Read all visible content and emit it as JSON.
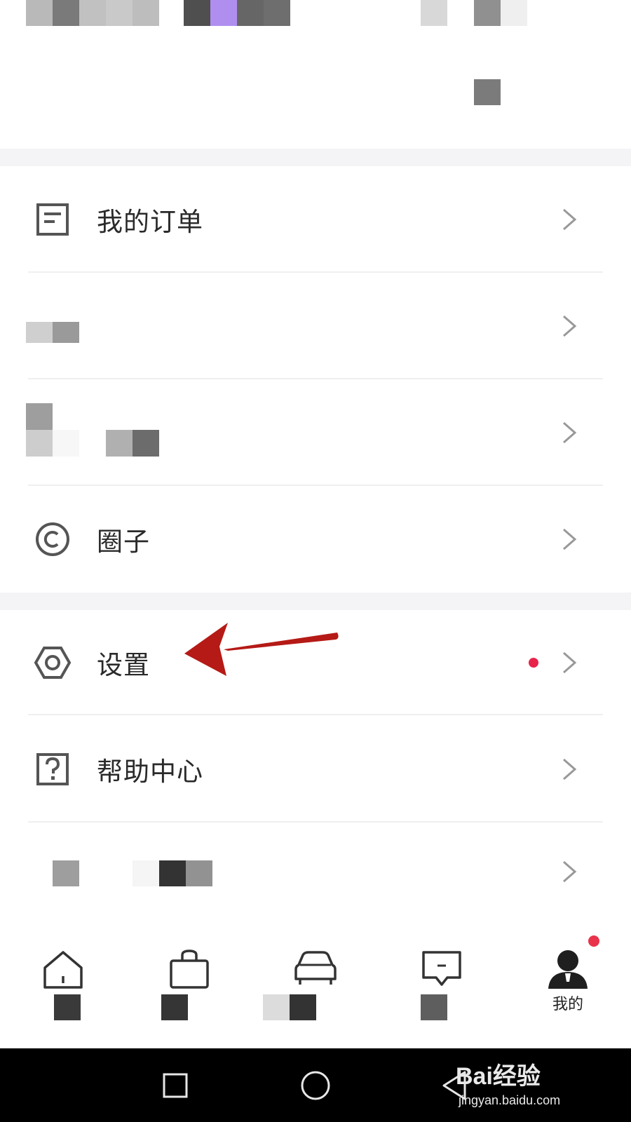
{
  "menu": {
    "orders_label": "我的订单",
    "circle_label": "圈子",
    "settings_label": "设置",
    "help_label": "帮助中心"
  },
  "tabbar": {
    "mine_label": "我的"
  },
  "watermark": {
    "brand": "Bai经验",
    "url": "jingyan.baidu.com"
  },
  "colors": {
    "accent_dot": "#e8244a",
    "annotation_arrow": "#b51a16",
    "section_gap": "#f4f4f6"
  },
  "icons": {
    "orders": "order-doc-icon",
    "circle": "circle-c-icon",
    "settings": "hexagon-gear-icon",
    "help": "question-box-icon",
    "home": "home-icon",
    "shop": "bag-icon",
    "car": "car-icon",
    "message": "message-icon",
    "mine": "person-icon"
  }
}
